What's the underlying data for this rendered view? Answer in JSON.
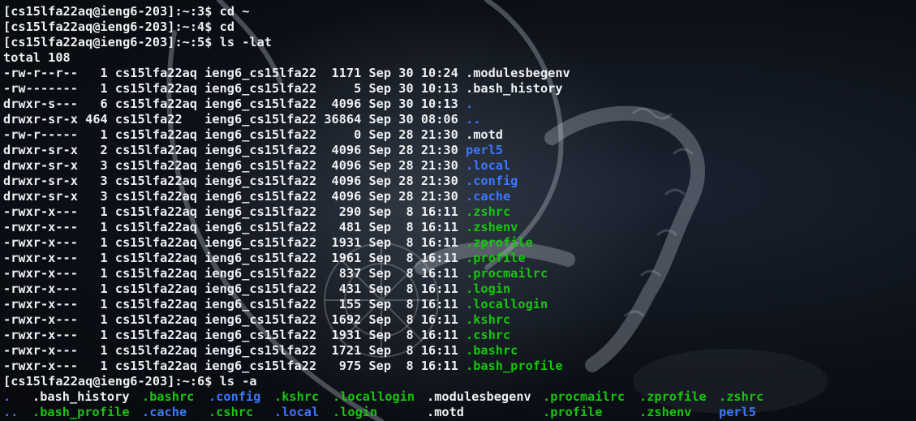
{
  "terminal": {
    "colors": {
      "background": "#0b0e13",
      "text": "#eef0f3",
      "directory": "#3b78ff",
      "executable": "#16c60c"
    },
    "session": [
      {
        "prompt": "[cs15lfa22aq@ieng6-203]:~:3$",
        "command": "cd ~"
      },
      {
        "prompt": "[cs15lfa22aq@ieng6-203]:~:4$",
        "command": "cd"
      },
      {
        "prompt": "[cs15lfa22aq@ieng6-203]:~:5$",
        "command": "ls -lat"
      }
    ],
    "total_line": "total 108",
    "listing": [
      {
        "meta": "-rw-r--r--   1 cs15lfa22aq ieng6_cs15lfa22  1171 Sep 30 10:24 ",
        "name": ".modulesbegenv",
        "type": "plain"
      },
      {
        "meta": "-rw-------   1 cs15lfa22aq ieng6_cs15lfa22     5 Sep 30 10:13 ",
        "name": ".bash_history",
        "type": "plain"
      },
      {
        "meta": "drwxr-s---   6 cs15lfa22aq ieng6_cs15lfa22  4096 Sep 30 10:13 ",
        "name": ".",
        "type": "dir"
      },
      {
        "meta": "drwxr-sr-x 464 cs15lfa22   ieng6_cs15lfa22 36864 Sep 30 08:06 ",
        "name": "..",
        "type": "dir"
      },
      {
        "meta": "-rw-r-----   1 cs15lfa22aq ieng6_cs15lfa22     0 Sep 28 21:30 ",
        "name": ".motd",
        "type": "plain"
      },
      {
        "meta": "drwxr-sr-x   2 cs15lfa22aq ieng6_cs15lfa22  4096 Sep 28 21:30 ",
        "name": "perl5",
        "type": "dir"
      },
      {
        "meta": "drwxr-sr-x   3 cs15lfa22aq ieng6_cs15lfa22  4096 Sep 28 21:30 ",
        "name": ".local",
        "type": "dir"
      },
      {
        "meta": "drwxr-sr-x   3 cs15lfa22aq ieng6_cs15lfa22  4096 Sep 28 21:30 ",
        "name": ".config",
        "type": "dir"
      },
      {
        "meta": "drwxr-sr-x   3 cs15lfa22aq ieng6_cs15lfa22  4096 Sep 28 21:30 ",
        "name": ".cache",
        "type": "dir"
      },
      {
        "meta": "-rwxr-x---   1 cs15lfa22aq ieng6_cs15lfa22   290 Sep  8 16:11 ",
        "name": ".zshrc",
        "type": "exec"
      },
      {
        "meta": "-rwxr-x---   1 cs15lfa22aq ieng6_cs15lfa22   481 Sep  8 16:11 ",
        "name": ".zshenv",
        "type": "exec"
      },
      {
        "meta": "-rwxr-x---   1 cs15lfa22aq ieng6_cs15lfa22  1931 Sep  8 16:11 ",
        "name": ".zprofile",
        "type": "exec"
      },
      {
        "meta": "-rwxr-x---   1 cs15lfa22aq ieng6_cs15lfa22  1961 Sep  8 16:11 ",
        "name": ".profile",
        "type": "exec"
      },
      {
        "meta": "-rwxr-x---   1 cs15lfa22aq ieng6_cs15lfa22   837 Sep  8 16:11 ",
        "name": ".procmailrc",
        "type": "exec"
      },
      {
        "meta": "-rwxr-x---   1 cs15lfa22aq ieng6_cs15lfa22   431 Sep  8 16:11 ",
        "name": ".login",
        "type": "exec"
      },
      {
        "meta": "-rwxr-x---   1 cs15lfa22aq ieng6_cs15lfa22   155 Sep  8 16:11 ",
        "name": ".locallogin",
        "type": "exec"
      },
      {
        "meta": "-rwxr-x---   1 cs15lfa22aq ieng6_cs15lfa22  1692 Sep  8 16:11 ",
        "name": ".kshrc",
        "type": "exec"
      },
      {
        "meta": "-rwxr-x---   1 cs15lfa22aq ieng6_cs15lfa22  1931 Sep  8 16:11 ",
        "name": ".cshrc",
        "type": "exec"
      },
      {
        "meta": "-rwxr-x---   1 cs15lfa22aq ieng6_cs15lfa22  1721 Sep  8 16:11 ",
        "name": ".bashrc",
        "type": "exec"
      },
      {
        "meta": "-rwxr-x---   1 cs15lfa22aq ieng6_cs15lfa22   975 Sep  8 16:11 ",
        "name": ".bash_profile",
        "type": "exec"
      }
    ],
    "last_command": {
      "prompt": "[cs15lfa22aq@ieng6-203]:~:6$",
      "command": "ls -a"
    },
    "ls_a": [
      [
        {
          "name": ".",
          "type": "dir"
        },
        {
          "name": ".bash_history",
          "type": "plain"
        },
        {
          "name": ".bashrc",
          "type": "exec"
        },
        {
          "name": ".config",
          "type": "dir"
        },
        {
          "name": ".kshrc",
          "type": "exec"
        },
        {
          "name": ".locallogin",
          "type": "exec"
        },
        {
          "name": ".modulesbegenv",
          "type": "plain"
        },
        {
          "name": ".procmailrc",
          "type": "exec"
        },
        {
          "name": ".zprofile",
          "type": "exec"
        },
        {
          "name": ".zshrc",
          "type": "exec"
        }
      ],
      [
        {
          "name": "..",
          "type": "dir"
        },
        {
          "name": ".bash_profile",
          "type": "exec"
        },
        {
          "name": ".cache",
          "type": "dir"
        },
        {
          "name": ".cshrc",
          "type": "exec"
        },
        {
          "name": ".local",
          "type": "dir"
        },
        {
          "name": ".login",
          "type": "exec"
        },
        {
          "name": ".motd",
          "type": "plain"
        },
        {
          "name": ".profile",
          "type": "exec"
        },
        {
          "name": ".zshenv",
          "type": "exec"
        },
        {
          "name": "perl5",
          "type": "dir"
        }
      ]
    ]
  }
}
